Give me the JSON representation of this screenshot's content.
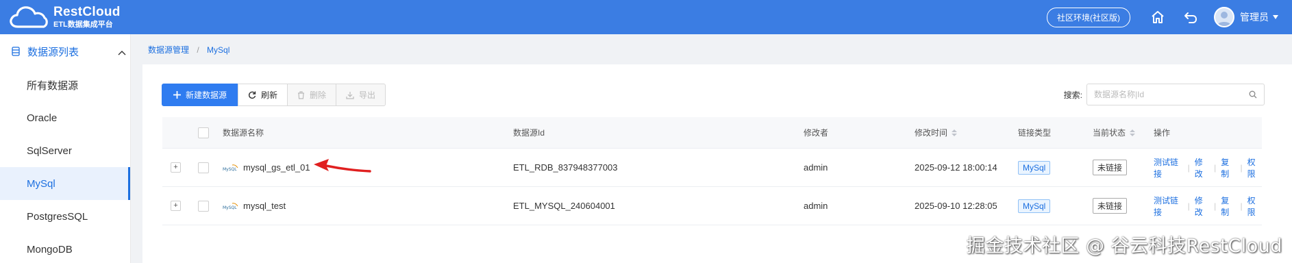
{
  "header": {
    "brand_title": "RestCloud",
    "brand_subtitle": "ETL数据集成平台",
    "env_badge": "社区环境(社区版)",
    "user_name": "管理员",
    "icons": [
      "home-icon",
      "undo-icon",
      "avatar",
      "caret-down-icon"
    ]
  },
  "sidebar": {
    "group_label": "数据源列表",
    "items": [
      {
        "label": "所有数据源",
        "active": false
      },
      {
        "label": "Oracle",
        "active": false
      },
      {
        "label": "SqlServer",
        "active": false
      },
      {
        "label": "MySql",
        "active": true
      },
      {
        "label": "PostgresSQL",
        "active": false
      },
      {
        "label": "MongoDB",
        "active": false
      }
    ]
  },
  "breadcrumb": {
    "items": [
      "数据源管理",
      "MySql"
    ],
    "separator": "/"
  },
  "toolbar": {
    "new_label": "新建数据源",
    "refresh_label": "刷新",
    "delete_label": "删除",
    "export_label": "导出"
  },
  "search": {
    "label": "搜索:",
    "placeholder": "数据源名称|Id",
    "value": ""
  },
  "table": {
    "columns": {
      "name": "数据源名称",
      "id": "数据源Id",
      "modifier": "修改者",
      "modified_time": "修改时间",
      "link_type": "链接类型",
      "status": "当前状态",
      "actions": "操作"
    },
    "rows": [
      {
        "name": "mysql_gs_etl_01",
        "id": "ETL_RDB_837948377003",
        "modifier": "admin",
        "modified_time": "2025-09-12 18:00:14",
        "link_type": "MySql",
        "status": "未链接"
      },
      {
        "name": "mysql_test",
        "id": "ETL_MYSQL_240604001",
        "modifier": "admin",
        "modified_time": "2025-09-10 12:28:05",
        "link_type": "MySql",
        "status": "未链接"
      }
    ],
    "actions": {
      "test": "测试链接",
      "edit": "修改",
      "copy": "复制",
      "perm": "权限"
    },
    "logo_text": "MySQL"
  },
  "watermark": "掘金技术社区 @ 谷云科技RestCloud",
  "colors": {
    "header_bg": "#3b7de3",
    "primary": "#2f7cf0",
    "link": "#1c6fe0",
    "annotation_arrow": "#e02020"
  }
}
